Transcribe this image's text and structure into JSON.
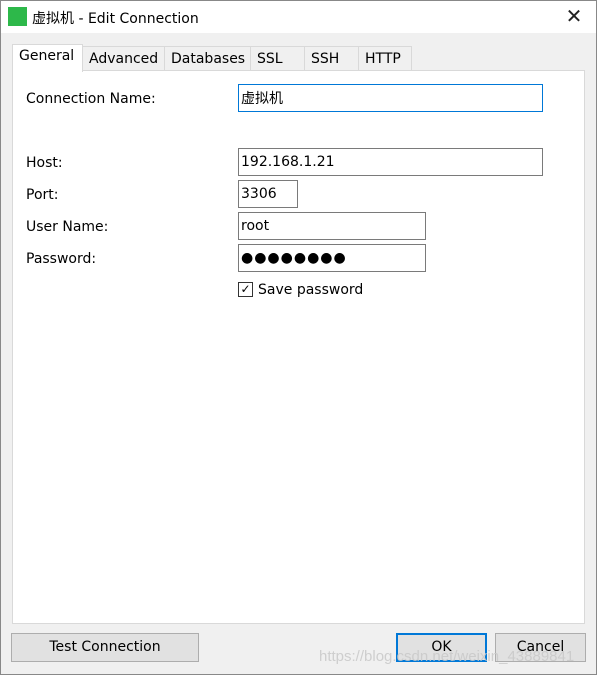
{
  "window": {
    "title": "虚拟机 - Edit Connection"
  },
  "tabs": [
    {
      "label": "General"
    },
    {
      "label": "Advanced"
    },
    {
      "label": "Databases"
    },
    {
      "label": "SSL"
    },
    {
      "label": "SSH"
    },
    {
      "label": "HTTP"
    }
  ],
  "form": {
    "connection_name_label": "Connection Name:",
    "connection_name": "虚拟机",
    "host_label": "Host:",
    "host": "192.168.1.21",
    "port_label": "Port:",
    "port": "3306",
    "username_label": "User Name:",
    "username": "root",
    "password_label": "Password:",
    "password": "●●●●●●●●",
    "save_password_label": "Save password",
    "save_password": true
  },
  "buttons": {
    "test": "Test Connection",
    "ok": "OK",
    "cancel": "Cancel"
  },
  "watermark": "https://blog.csdn.net/weixin_43889841",
  "colors": {
    "accent": "#0078d7",
    "app_icon": "#2db84a"
  }
}
